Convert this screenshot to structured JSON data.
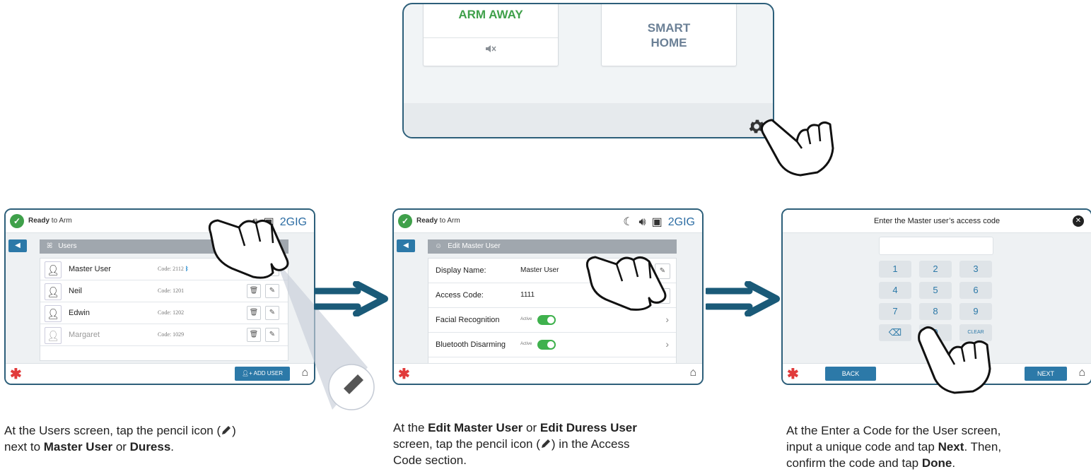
{
  "top": {
    "arm_away": "ARM AWAY",
    "smart_home": [
      "SMART",
      "HOME"
    ],
    "mute_icon": "speaker-muted-icon",
    "settings_icon": "gear-icon"
  },
  "status": {
    "ready_bold": "Ready",
    "ready_rest": " to Arm",
    "brand": "2GIG"
  },
  "screen1": {
    "title": "Users",
    "users": [
      {
        "name": "Master User",
        "code": "Code: 2112"
      },
      {
        "name": "Neil",
        "code": "Code: 1201"
      },
      {
        "name": "Edwin",
        "code": "Code: 1202"
      },
      {
        "name": "Margaret",
        "code": "Code: 1029"
      }
    ],
    "add_user": "ADD USER"
  },
  "screen2": {
    "title": "Edit Master User",
    "fields": [
      {
        "label": "Display Name:",
        "value": "Master User"
      },
      {
        "label": "Access Code:",
        "value": "1111"
      },
      {
        "label": "Facial Recognition",
        "value": "Active"
      },
      {
        "label": "Bluetooth Disarming",
        "value": "Active"
      }
    ]
  },
  "screen3": {
    "prompt": "Enter the Master user’s access code",
    "keys": [
      "1",
      "2",
      "3",
      "4",
      "5",
      "6",
      "7",
      "8",
      "9",
      "0"
    ],
    "clear": "CLEAR",
    "back": "BACK",
    "next": "NEXT"
  },
  "captions": {
    "c1_a": "At the Users screen, tap the pencil icon (",
    "c1_b": ")",
    "c1_c": "next to ",
    "c1_d": "Master User",
    "c1_e": " or ",
    "c1_f": "Duress",
    "c1_g": ".",
    "c2_a": "At the ",
    "c2_b": "Edit Master User",
    "c2_c": " or ",
    "c2_d": "Edit Duress User",
    "c2_e": "screen, tap the pencil icon (",
    "c2_f": ") in the Access",
    "c2_g": "Code section.",
    "c3_a": "At the Enter a Code for the User screen,",
    "c3_b": "input a unique code and tap ",
    "c3_c": "Next",
    "c3_d": ". Then,",
    "c3_e": "confirm the code and tap ",
    "c3_f": "Done",
    "c3_g": "."
  },
  "colors": {
    "accent": "#2c79a8",
    "frame": "#2d5f7a",
    "green": "#3fa04a",
    "alert": "#e13a3a"
  }
}
